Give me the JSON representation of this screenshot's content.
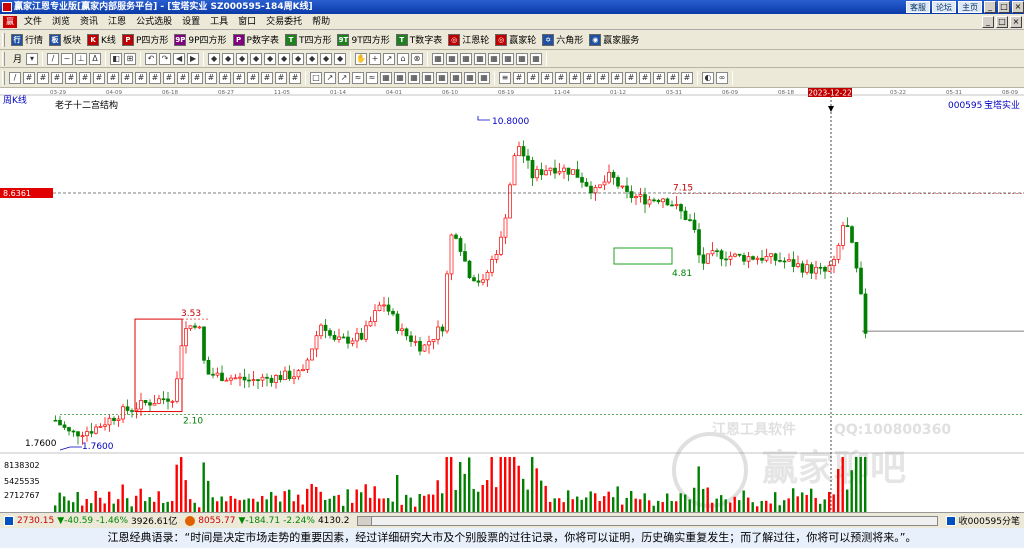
{
  "window": {
    "title": "赢家江恩专业版[赢家内部服务平台] - [宝塔实业   SZ000595-184周K线]",
    "links": [
      "客服",
      "论坛",
      "主页"
    ],
    "buttons": [
      "_",
      "□",
      "×"
    ]
  },
  "menu": {
    "logo": "赢",
    "items": [
      "文件",
      "浏览",
      "资讯",
      "江恩",
      "公式选股",
      "设置",
      "工具",
      "窗口",
      "交易委托",
      "帮助"
    ],
    "mdi_buttons": [
      "_",
      "□",
      "×"
    ]
  },
  "toolbar1": [
    {
      "icon": "行",
      "label": "行情",
      "color": "#2050a0"
    },
    {
      "icon": "板",
      "label": "板块",
      "color": "#2050a0"
    },
    {
      "icon": "K",
      "label": "K线",
      "color": "#c00000"
    },
    {
      "icon": "P",
      "label": "P四方形",
      "color": "#c00000"
    },
    {
      "icon": "9P",
      "label": "9P四方形",
      "color": "#800080"
    },
    {
      "icon": "P",
      "label": "P数字表",
      "color": "#800080"
    },
    {
      "icon": "T",
      "label": "T四方形",
      "color": "#208020"
    },
    {
      "icon": "9T",
      "label": "9T四方形",
      "color": "#208020"
    },
    {
      "icon": "T",
      "label": "T数字表",
      "color": "#208020"
    },
    {
      "icon": "◎",
      "label": "江恩轮",
      "color": "#c00000"
    },
    {
      "icon": "◎",
      "label": "赢家轮",
      "color": "#c00000"
    },
    {
      "icon": "✡",
      "label": "六角形",
      "color": "#2050a0"
    },
    {
      "icon": "◉",
      "label": "赢家服务",
      "color": "#2050a0"
    }
  ],
  "toolbar2": {
    "period": "月",
    "groups": [
      [
        "/",
        "~",
        "⊥",
        "Δ"
      ],
      [
        "◧",
        "⊞"
      ],
      [
        "↶",
        "↷",
        "◀",
        "▶"
      ],
      [
        "◆",
        "◆",
        "◆",
        "◆",
        "◆",
        "◆",
        "◆",
        "◆",
        "◆",
        "◆"
      ],
      [
        "✋",
        "+",
        "↗",
        "⌂",
        "⊗"
      ],
      [
        "▦",
        "▦",
        "▦",
        "▦",
        "▦",
        "▦",
        "▦",
        "▦"
      ]
    ]
  },
  "toolbar3": {
    "groups": [
      [
        "/",
        "#",
        "#",
        "#",
        "#",
        "#",
        "#",
        "#",
        "#",
        "#",
        "#",
        "#",
        "#",
        "#",
        "#",
        "#",
        "#",
        "#",
        "#",
        "#",
        "#"
      ],
      [
        "□",
        "↗",
        "↗",
        "≈",
        "≈",
        "▦",
        "▦",
        "▦",
        "▦",
        "▦",
        "▦",
        "▦",
        "▦"
      ],
      [
        "≡",
        "#",
        "#",
        "#",
        "#",
        "#",
        "#",
        "#",
        "#",
        "#",
        "#",
        "#",
        "#",
        "#"
      ],
      [
        "◐",
        "∞"
      ]
    ]
  },
  "chart_data": {
    "type": "candlestick",
    "period_label": "周K线",
    "indicator_title": "老子十二宫结构",
    "stock_code": "000595",
    "stock_name": "宝塔实业",
    "date_ticks": [
      "03-29",
      "04-09",
      "06-18",
      "08-27",
      "11-05",
      "01-14",
      "04-01",
      "06-10",
      "08-19",
      "11-04",
      "01-12",
      "03-31",
      "06-09",
      "08-18",
      "10-03",
      "03-22",
      "05-31",
      "08-09"
    ],
    "cursor_date": "2023-12-22",
    "price_axis_marker": "8.6361",
    "annotations": {
      "high": "10.8000",
      "low": "1.7600",
      "low_axis_label": "1.7600",
      "box1_top": "3.53",
      "box1_bottom": "2.10",
      "box2_top": "7.15",
      "box2_bottom": "4.81"
    },
    "volume_axis": [
      "8138302",
      "5425535",
      "2712767"
    ],
    "watermarks": [
      "江恩工具软件",
      "QQ:100800360",
      "赢家聊吧"
    ],
    "up_color": "#ff0000",
    "down_color": "#008000"
  },
  "status": {
    "sh_value": "2730.15",
    "sh_change": "▼-40.59",
    "sh_pct": "-1.46%",
    "sh_amount": "3926.61亿",
    "sz_value": "8055.77",
    "sz_change": "▼-184.71",
    "sz_pct": "-2.24%",
    "sz_amount": "4130.2",
    "right_text": "收000595分笔"
  },
  "quote": "江恩经典语录：“时间是决定市场走势的重要因素，经过详细研究大市及个别股票的过往记录，你将可以证明，历史确实重复发生；而了解过往，你将可以预测将来。”。"
}
